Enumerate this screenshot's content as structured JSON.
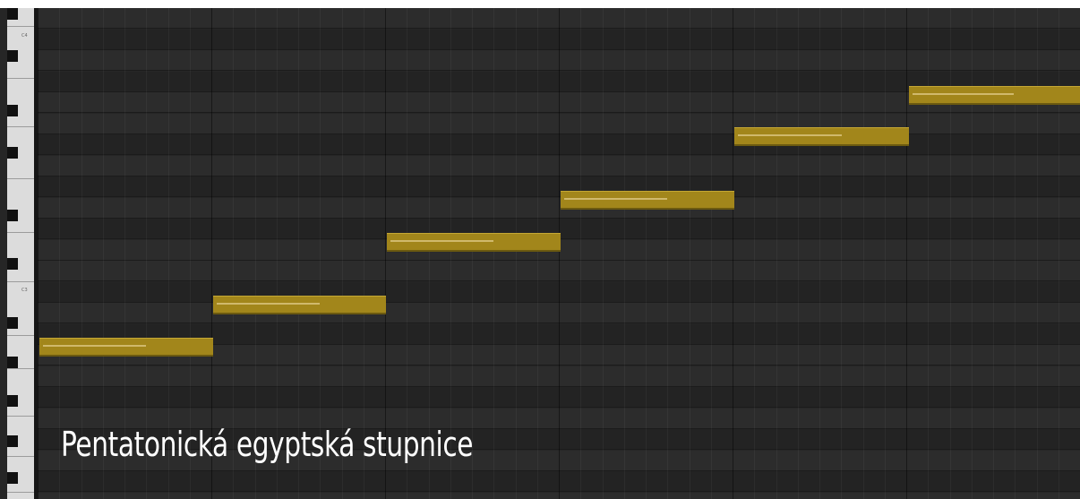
{
  "piano_roll": {
    "octave_labels": [
      "C4",
      "C3"
    ],
    "note_color": "#a2861b",
    "velocity_color": "#d8c27a",
    "background": "#262626",
    "notes": [
      {
        "step": 1,
        "velocity_fraction": 0.62
      },
      {
        "step": 2,
        "velocity_fraction": 0.62
      },
      {
        "step": 3,
        "velocity_fraction": 0.62
      },
      {
        "step": 4,
        "velocity_fraction": 0.62
      },
      {
        "step": 5,
        "velocity_fraction": 0.62
      },
      {
        "step": 6,
        "velocity_fraction": 0.62
      }
    ]
  },
  "caption": "Pentatonická egyptská stupnice"
}
